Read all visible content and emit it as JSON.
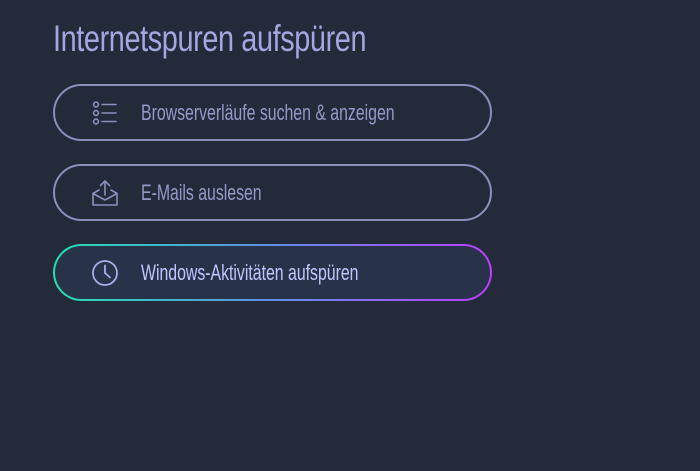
{
  "page": {
    "title": "Internetspuren aufspüren"
  },
  "options": [
    {
      "label": "Browserverläufe suchen & anzeigen",
      "icon": "list-icon",
      "selected": false
    },
    {
      "label": "E-Mails auslesen",
      "icon": "mail-upload-icon",
      "selected": false
    },
    {
      "label": "Windows-Aktivitäten aufspüren",
      "icon": "clock-icon",
      "selected": true
    }
  ],
  "colors": {
    "background": "#232b3a",
    "title": "#a3a7e0",
    "option_border": "#8a90bd",
    "option_text": "#9599c8",
    "selected_text": "#c2c6ff",
    "selected_fill": "#283249",
    "selected_gradient_start": "#22e0b0",
    "selected_gradient_end": "#c03cff"
  }
}
